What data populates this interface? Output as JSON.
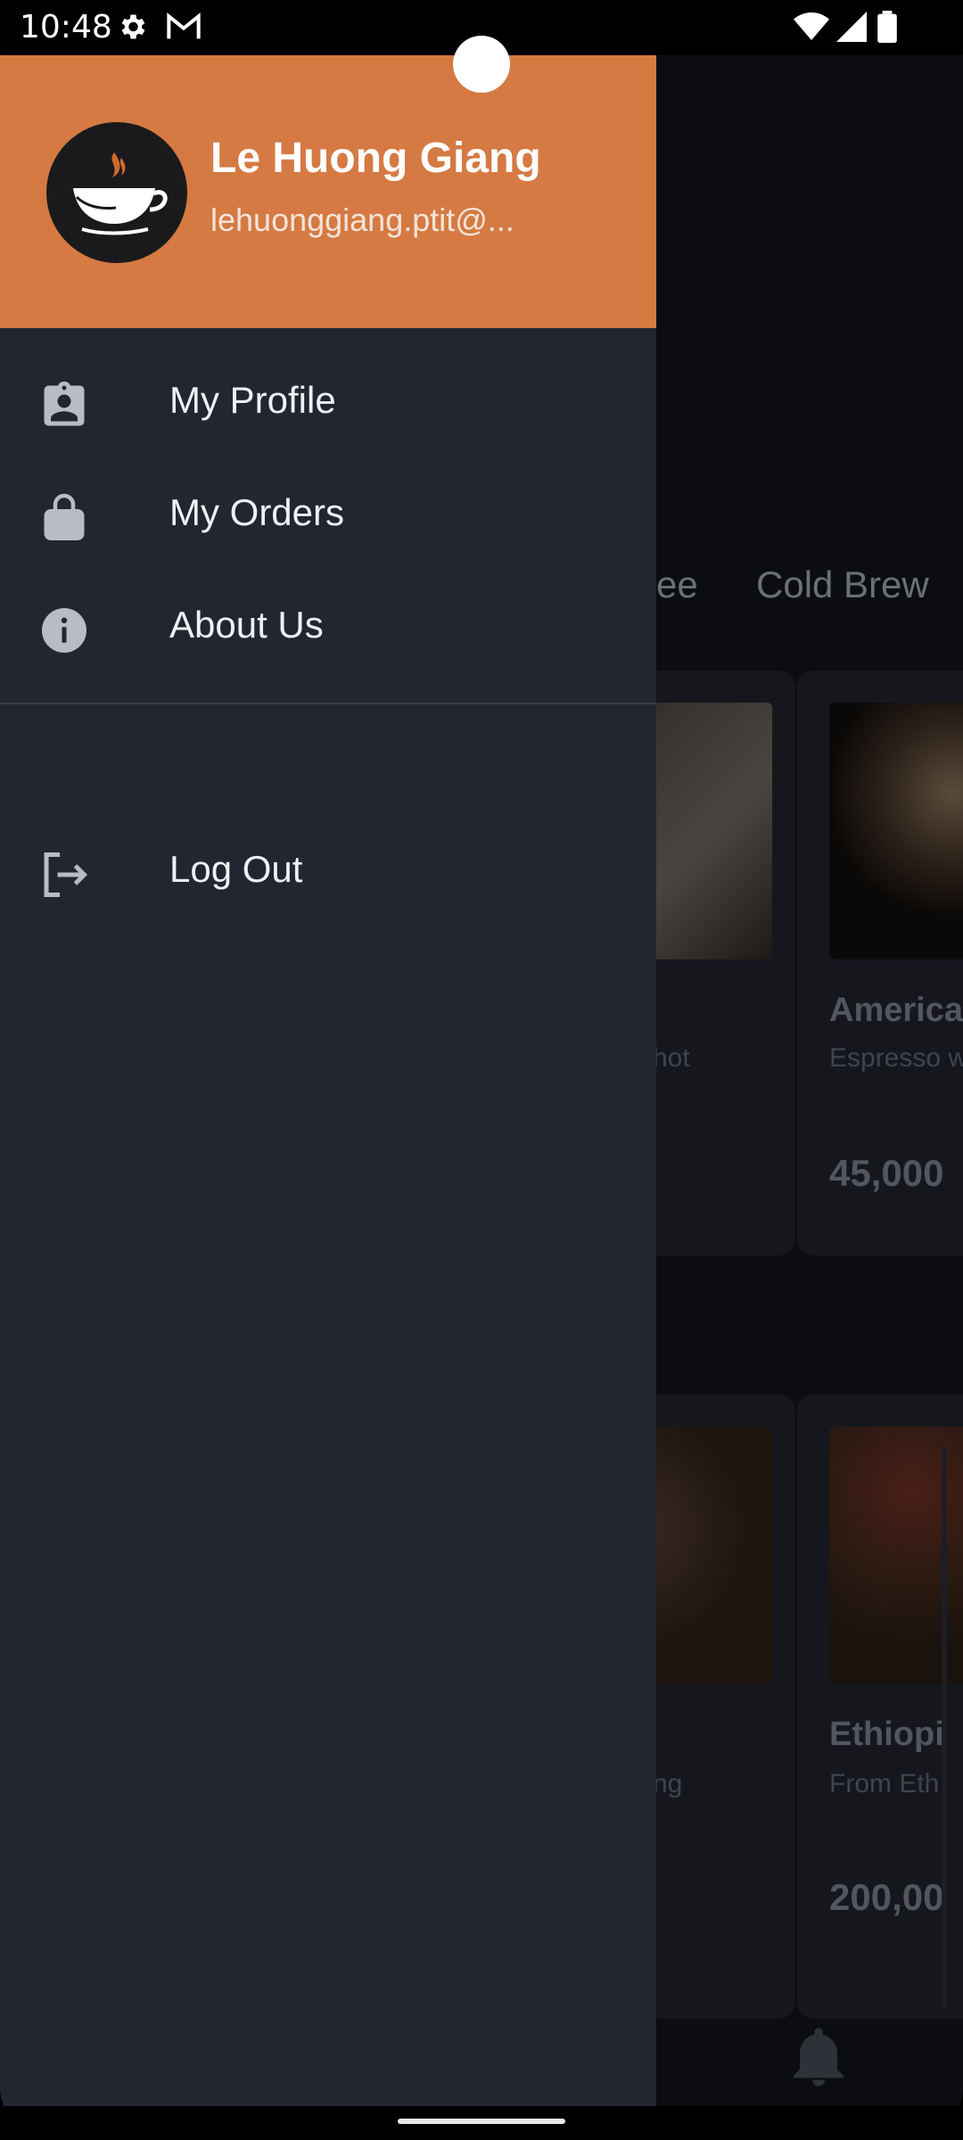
{
  "status_bar": {
    "time": "10:48"
  },
  "drawer": {
    "header_color": "#d57a43",
    "user_name": "Le Huong Giang",
    "user_email": "lehuonggiang.ptit@...",
    "menu": [
      {
        "label": "My Profile",
        "icon": "profile-badge-icon"
      },
      {
        "label": "My Orders",
        "icon": "shopping-bag-icon"
      },
      {
        "label": "About Us",
        "icon": "info-icon"
      }
    ],
    "logout_label": "Log Out"
  },
  "background": {
    "tabs": [
      "ee",
      "Cold Brew"
    ],
    "cards": [
      {
        "title": "",
        "desc": "hot",
        "price": ""
      },
      {
        "title": "America",
        "desc": "Espresso w",
        "price": "45,000"
      },
      {
        "title": "",
        "desc": "ng",
        "price": ""
      },
      {
        "title": "Ethiopi",
        "desc": "From Eth",
        "price": "200,00"
      }
    ]
  }
}
